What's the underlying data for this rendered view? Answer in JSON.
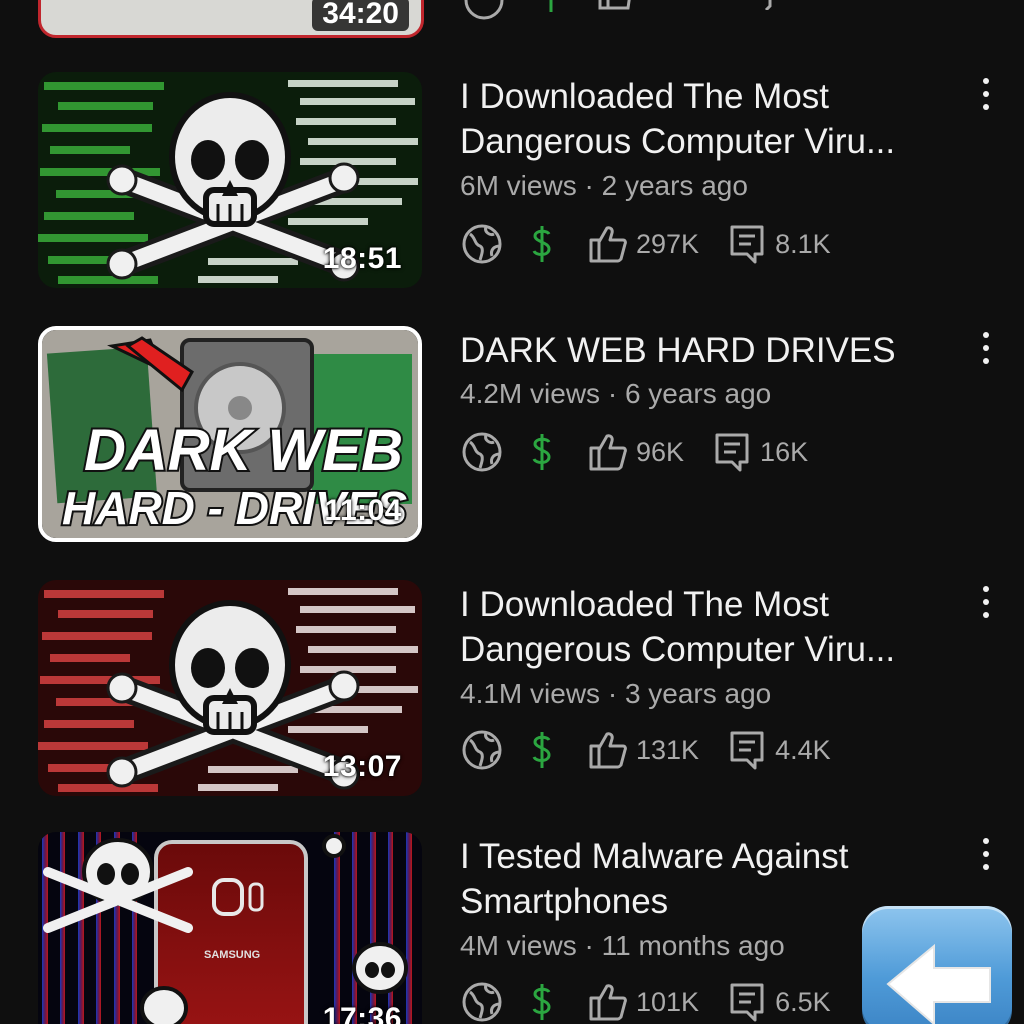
{
  "partial_top_row": {
    "duration": "34:20"
  },
  "videos": [
    {
      "title": "I Downloaded The Most Dangerous Computer Viru...",
      "views": "6M views",
      "age": "2 years ago",
      "likes": "297K",
      "comments": "8.1K",
      "duration": "18:51",
      "thumb_theme": "green"
    },
    {
      "title": "DARK WEB HARD DRIVES",
      "views": "4.2M views",
      "age": "6 years ago",
      "likes": "96K",
      "comments": "16K",
      "duration": "11:04",
      "thumb_theme": "harddrives",
      "thumb_text_1": "DARK WEB",
      "thumb_text_2": "HARD - DRIVES"
    },
    {
      "title": "I Downloaded The Most Dangerous Computer Viru...",
      "views": "4.1M views",
      "age": "3 years ago",
      "likes": "131K",
      "comments": "4.4K",
      "duration": "13:07",
      "thumb_theme": "red"
    },
    {
      "title": "I Tested Malware Against Smartphones",
      "views": "4M views",
      "age": "11 months ago",
      "likes": "101K",
      "comments": "6.5K",
      "duration": "17:36",
      "thumb_theme": "phone",
      "thumb_brand": "SAMSUNG"
    }
  ],
  "separator": " · ",
  "icons": {
    "public": "globe-icon",
    "monetized": "dollar-icon",
    "likes": "thumbs-up-icon",
    "comments": "comment-icon",
    "more": "more-vertical-icon",
    "back": "left-arrow-emoji-icon"
  },
  "colors": {
    "background": "#0f0f0f",
    "title": "#f1f1f1",
    "meta": "#aaaaaa",
    "monetized": "#2ba640",
    "code_green": "#3fbf3f",
    "code_red": "#e04545",
    "selected_border": "#ffffff",
    "partial_border": "#c0262d"
  }
}
